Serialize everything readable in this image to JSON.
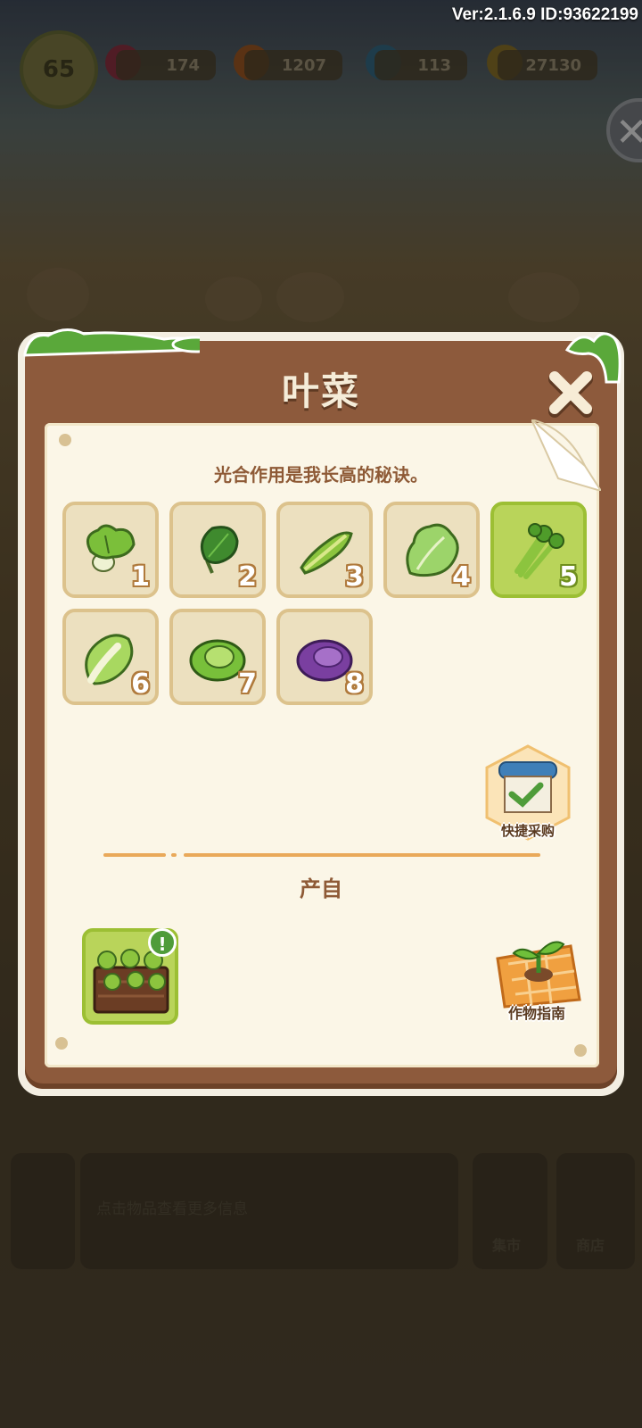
{
  "header": {
    "version": "Ver:2.1.6.9 ID:93622199",
    "level": "65",
    "gems": "174",
    "carrots": "1207",
    "energy": "113",
    "coins": "27130"
  },
  "modal": {
    "title": "叶菜",
    "description": "光合作用是我长高的秘诀。",
    "items": [
      {
        "level": "1",
        "icon": "bok-choy-icon"
      },
      {
        "level": "2",
        "icon": "spinach-icon"
      },
      {
        "level": "3",
        "icon": "lettuce-stem-icon"
      },
      {
        "level": "4",
        "icon": "curly-lettuce-icon"
      },
      {
        "level": "5",
        "icon": "celery-icon"
      },
      {
        "level": "6",
        "icon": "napa-cabbage-icon"
      },
      {
        "level": "7",
        "icon": "green-cabbage-icon"
      },
      {
        "level": "8",
        "icon": "purple-cabbage-icon"
      }
    ],
    "selected_level": "5",
    "quick_buy_label": "快捷采购",
    "produce_title": "产自",
    "crop_guide_label": "作物指南",
    "badge": "!"
  },
  "bottom": {
    "hint": "点击物品查看更多信息",
    "market_label": "集市",
    "shop_label": "商店"
  },
  "colors": {
    "wood": "#8d5a3c",
    "paper": "#fbf6e7",
    "tile": "#ece0bf",
    "tile_selected": "#b9d45a",
    "text_brown": "#8e5a36"
  }
}
